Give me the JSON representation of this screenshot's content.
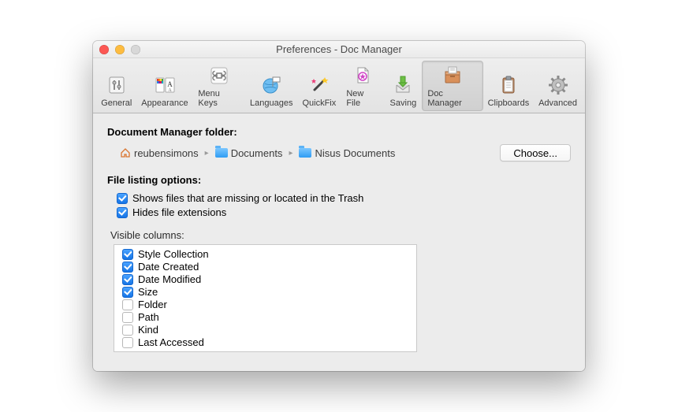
{
  "window": {
    "title": "Preferences - Doc Manager"
  },
  "toolbar": {
    "items": [
      {
        "label": "General",
        "selected": false
      },
      {
        "label": "Appearance",
        "selected": false
      },
      {
        "label": "Menu Keys",
        "selected": false
      },
      {
        "label": "Languages",
        "selected": false
      },
      {
        "label": "QuickFix",
        "selected": false
      },
      {
        "label": "New File",
        "selected": false
      },
      {
        "label": "Saving",
        "selected": false
      },
      {
        "label": "Doc Manager",
        "selected": true
      },
      {
        "label": "Clipboards",
        "selected": false
      },
      {
        "label": "Advanced",
        "selected": false
      }
    ]
  },
  "folder_section": {
    "label": "Document Manager folder:",
    "breadcrumb": [
      {
        "icon": "home",
        "label": "reubensimons"
      },
      {
        "icon": "folder",
        "label": "Documents"
      },
      {
        "icon": "folder",
        "label": "Nisus Documents"
      }
    ],
    "choose_label": "Choose..."
  },
  "listing_section": {
    "label": "File listing options:",
    "options": [
      {
        "checked": true,
        "label": "Shows files that are missing or located in the Trash"
      },
      {
        "checked": true,
        "label": "Hides file extensions"
      }
    ],
    "visible_columns_label": "Visible columns:",
    "columns": [
      {
        "checked": true,
        "label": "Style Collection"
      },
      {
        "checked": true,
        "label": "Date Created"
      },
      {
        "checked": true,
        "label": "Date Modified"
      },
      {
        "checked": true,
        "label": "Size"
      },
      {
        "checked": false,
        "label": "Folder"
      },
      {
        "checked": false,
        "label": "Path"
      },
      {
        "checked": false,
        "label": "Kind"
      },
      {
        "checked": false,
        "label": "Last Accessed"
      }
    ]
  }
}
